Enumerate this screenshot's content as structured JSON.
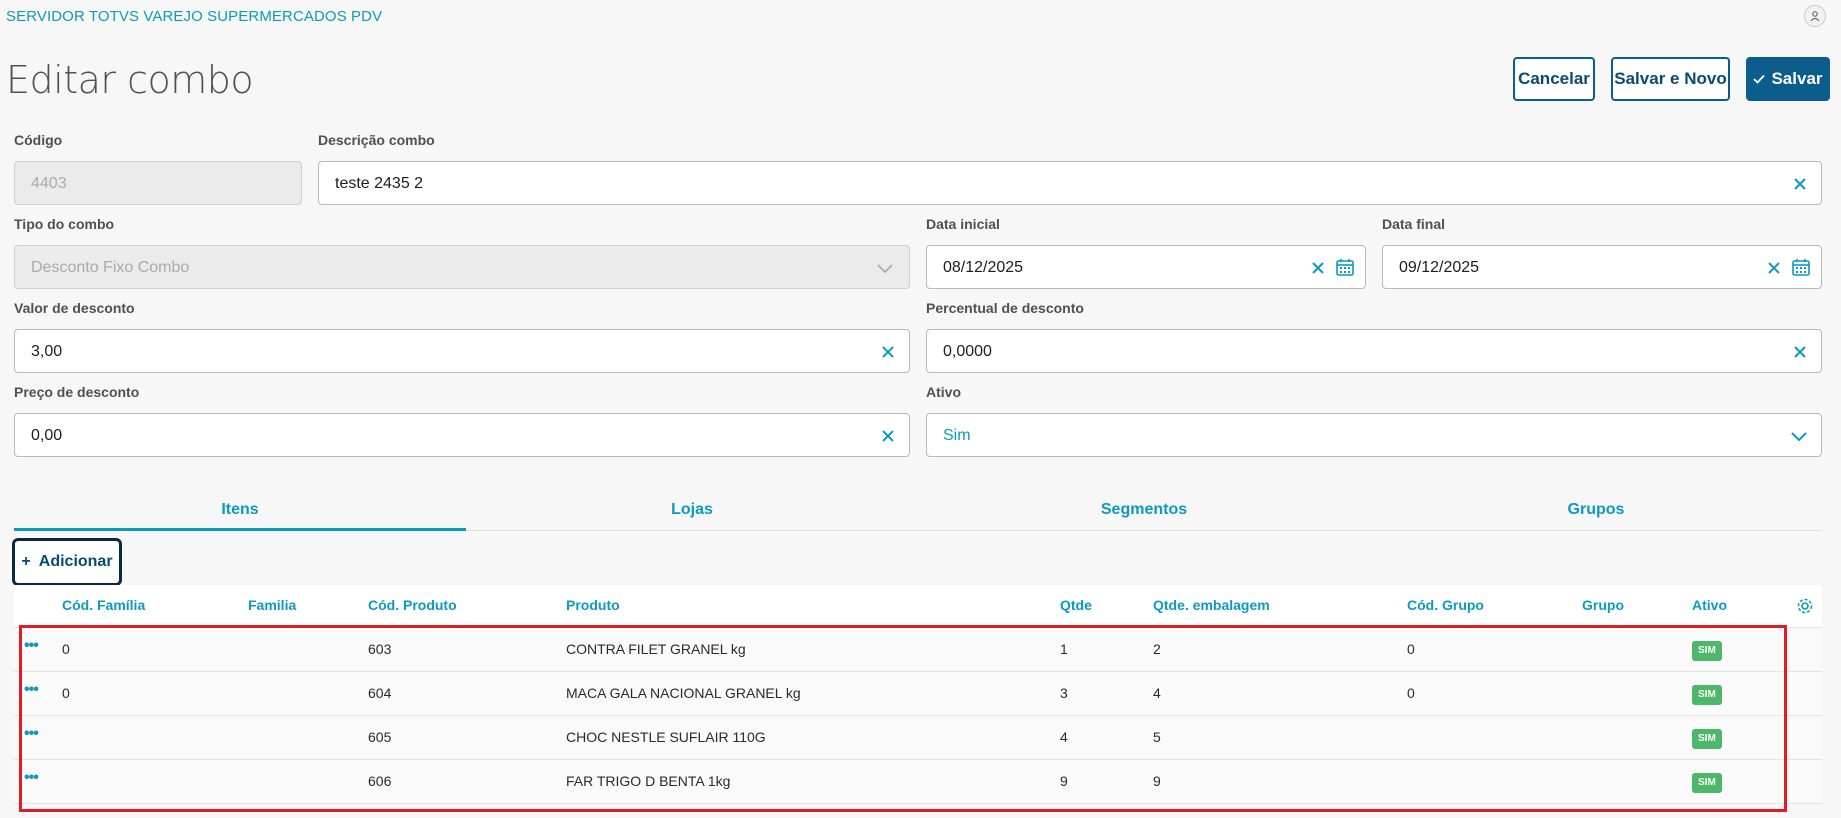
{
  "app": {
    "title": "SERVIDOR TOTVS VAREJO SUPERMERCADOS PDV",
    "user_icon": "user-icon"
  },
  "page": {
    "title": "Editar combo"
  },
  "actions": {
    "cancel": "Cancelar",
    "save_new": "Salvar e Novo",
    "save": "Salvar"
  },
  "form": {
    "codigo": {
      "label": "Código",
      "value": "4403"
    },
    "descricao": {
      "label": "Descrição combo",
      "value": "teste 2435 2"
    },
    "tipo": {
      "label": "Tipo do combo",
      "value": "Desconto Fixo Combo"
    },
    "data_inicial": {
      "label": "Data inicial",
      "value": "08/12/2025"
    },
    "data_final": {
      "label": "Data final",
      "value": "09/12/2025"
    },
    "valor_desconto": {
      "label": "Valor de desconto",
      "value": "3,00"
    },
    "percentual_desconto": {
      "label": "Percentual de desconto",
      "value": "0,0000"
    },
    "preco_desconto": {
      "label": "Preço de desconto",
      "value": "0,00"
    },
    "ativo": {
      "label": "Ativo",
      "value": "Sim"
    }
  },
  "tabs": [
    {
      "label": "Itens",
      "active": true
    },
    {
      "label": "Lojas",
      "active": false
    },
    {
      "label": "Segmentos",
      "active": false
    },
    {
      "label": "Grupos",
      "active": false
    }
  ],
  "add_button": {
    "label": "Adicionar"
  },
  "table": {
    "columns": [
      "Cód. Família",
      "Familia",
      "Cód. Produto",
      "Produto",
      "Qtde",
      "Qtde. embalagem",
      "Cód. Grupo",
      "Grupo",
      "Ativo"
    ],
    "rows": [
      {
        "cod_familia": "0",
        "familia": "",
        "cod_produto": "603",
        "produto": "CONTRA FILET GRANEL kg",
        "qtde": "1",
        "qtde_emb": "2",
        "cod_grupo": "0",
        "grupo": "",
        "ativo": "SIM"
      },
      {
        "cod_familia": "0",
        "familia": "",
        "cod_produto": "604",
        "produto": "MACA GALA NACIONAL GRANEL kg",
        "qtde": "3",
        "qtde_emb": "4",
        "cod_grupo": "0",
        "grupo": "",
        "ativo": "SIM"
      },
      {
        "cod_familia": "",
        "familia": "",
        "cod_produto": "605",
        "produto": "CHOC NESTLE SUFLAIR 110G",
        "qtde": "4",
        "qtde_emb": "5",
        "cod_grupo": "",
        "grupo": "",
        "ativo": "SIM"
      },
      {
        "cod_familia": "",
        "familia": "",
        "cod_produto": "606",
        "produto": "FAR TRIGO D BENTA 1kg",
        "qtde": "9",
        "qtde_emb": "9",
        "cod_grupo": "",
        "grupo": "",
        "ativo": "SIM"
      }
    ]
  },
  "colors": {
    "accent": "#0c9abe",
    "primary": "#0b5d8c",
    "success": "#4cb669",
    "highlight": "#e31c23"
  }
}
